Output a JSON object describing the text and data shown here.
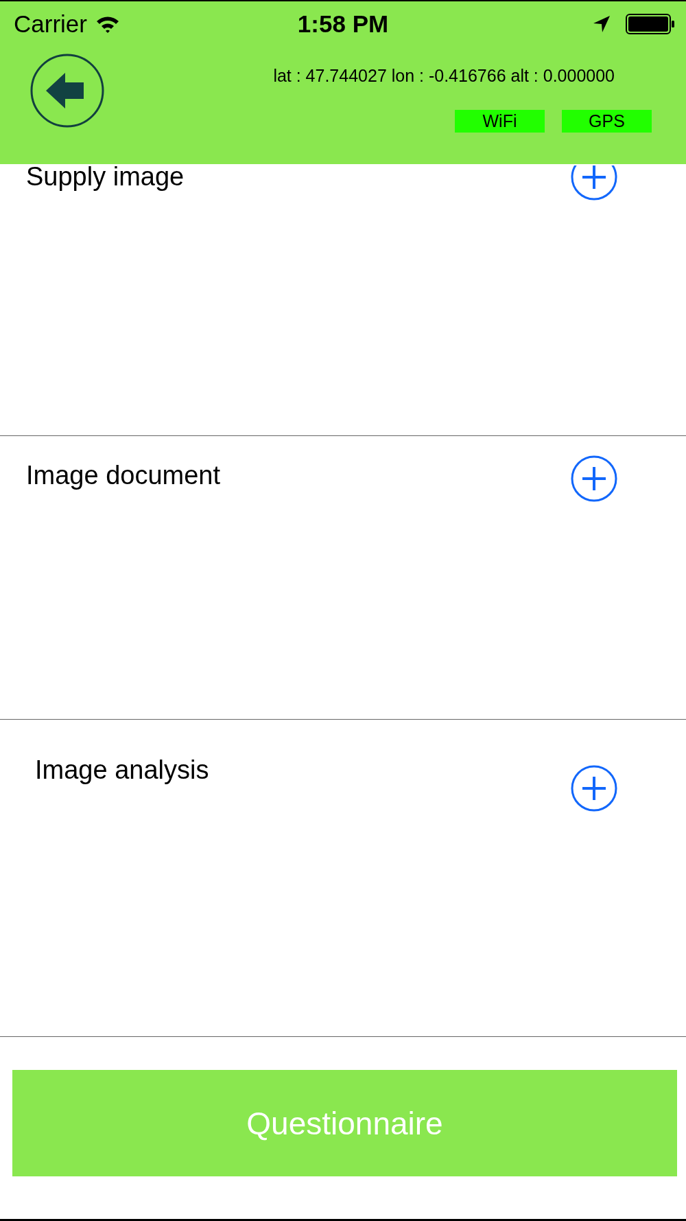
{
  "status_bar": {
    "carrier": "Carrier",
    "time": "1:58 PM"
  },
  "header": {
    "coordinates": "lat : 47.744027 lon : -0.416766 alt : 0.000000",
    "badges": [
      "WiFi",
      "GPS"
    ]
  },
  "sections": [
    {
      "title": "Supply image"
    },
    {
      "title": "Image document"
    },
    {
      "title": "Image analysis"
    }
  ],
  "button": "Questionnaire"
}
